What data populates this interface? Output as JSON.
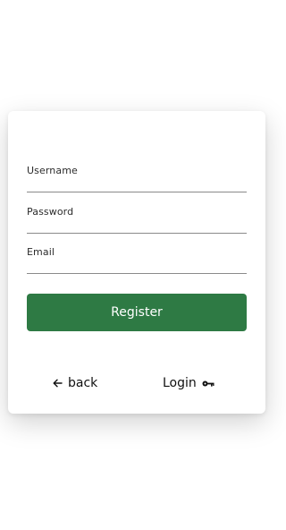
{
  "form": {
    "fields": [
      {
        "label": "Username",
        "value": ""
      },
      {
        "label": "Password",
        "value": ""
      },
      {
        "label": "Email",
        "value": ""
      }
    ],
    "register_label": "Register"
  },
  "footer": {
    "back_label": "back",
    "back_icon": "arrow-left-icon",
    "login_label": "Login",
    "login_icon": "key-icon"
  },
  "colors": {
    "primary_button": "#2e7a44",
    "field_underline": "#8a8a8a"
  }
}
